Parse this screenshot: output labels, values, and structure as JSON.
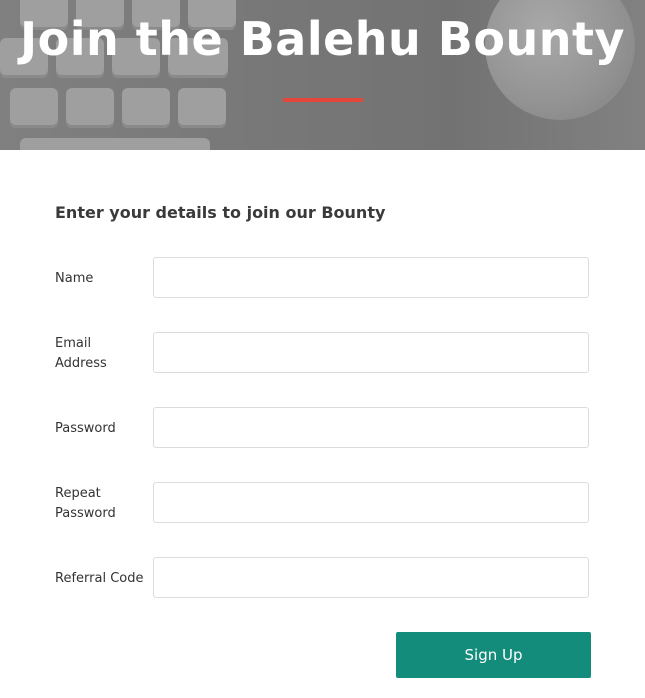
{
  "hero": {
    "title": "Join the Balehu Bounty",
    "accent_color": "#e4463a"
  },
  "form": {
    "heading": "Enter your details to join our Bounty",
    "fields": [
      {
        "label": "Name",
        "value": "",
        "placeholder": ""
      },
      {
        "label": "Email Address",
        "value": "",
        "placeholder": ""
      },
      {
        "label": "Password",
        "value": "",
        "placeholder": ""
      },
      {
        "label": "Repeat Password",
        "value": "",
        "placeholder": ""
      },
      {
        "label": "Referral Code",
        "value": "",
        "placeholder": ""
      }
    ],
    "submit_label": "Sign Up",
    "submit_color": "#138c7c"
  }
}
